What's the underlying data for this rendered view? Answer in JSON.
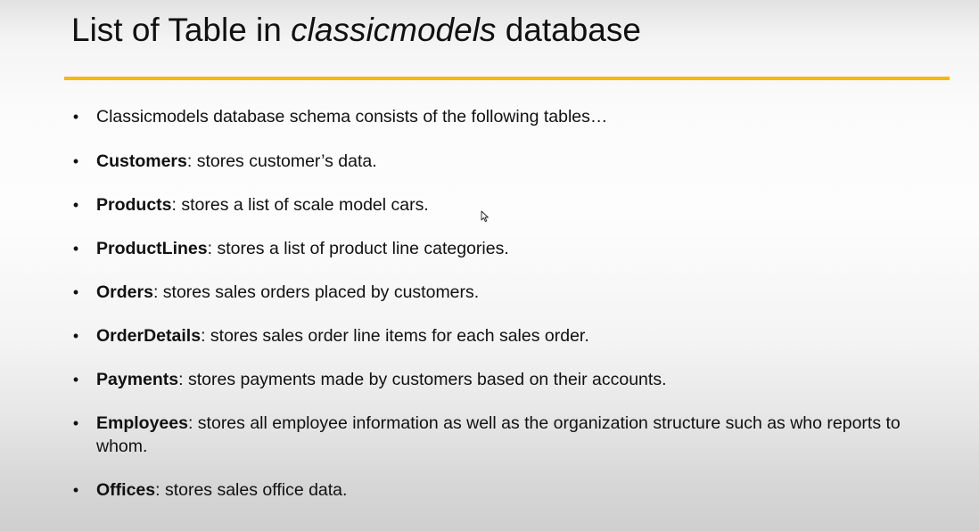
{
  "slide": {
    "title_prefix": "List of Table in ",
    "title_italic": "classicmodels",
    "title_suffix": " database",
    "accent_color": "#f5b80f",
    "bullet_glyph": "•",
    "items": [
      {
        "term": "",
        "text": "Classicmodels database schema consists of the following tables…"
      },
      {
        "term": "Customers",
        "text": ": stores customer’s data."
      },
      {
        "term": "Products",
        "text": ": stores a list of scale model cars."
      },
      {
        "term": "ProductLines",
        "text": ": stores a list of product line categories."
      },
      {
        "term": "Orders",
        "text": ": stores sales orders placed by customers."
      },
      {
        "term": "OrderDetails",
        "text": ": stores sales order line items for each sales order."
      },
      {
        "term": "Payments",
        "text": ": stores payments made by customers based on their accounts."
      },
      {
        "term": "Employees",
        "text": ": stores all employee information as well as the organization structure such as who reports to whom."
      },
      {
        "term": "Offices",
        "text": ": stores sales office data."
      }
    ]
  },
  "icons": {
    "cursor": "mouse-pointer-icon"
  }
}
